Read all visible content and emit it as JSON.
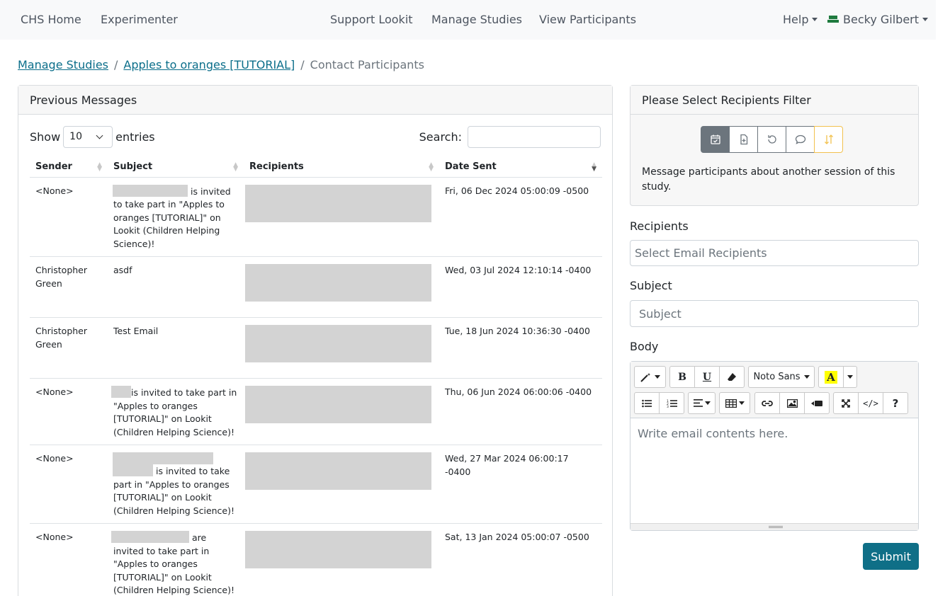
{
  "nav": {
    "home": "CHS Home",
    "experimenter": "Experimenter",
    "support": "Support Lookit",
    "manage": "Manage Studies",
    "participants": "View Participants",
    "help": "Help",
    "user": "Becky Gilbert"
  },
  "breadcrumb": {
    "item1": "Manage Studies",
    "item2": "Apples to oranges [TUTORIAL]",
    "current": "Contact Participants",
    "sep": "/"
  },
  "previous": {
    "title": "Previous Messages",
    "show_label": "Show",
    "entries_value": "10",
    "entries_label": "entries",
    "search_label": "Search:",
    "columns": [
      "Sender",
      "Subject",
      "Recipients",
      "Date Sent"
    ],
    "rows": [
      {
        "sender": "<None>",
        "subject": "is invited to take part in \"Apples to oranges [TUTORIAL]\" on Lookit (Children Helping Science)!",
        "date": "Fri, 06 Dec 2024 05:00:09 -0500"
      },
      {
        "sender": "Christopher Green",
        "subject": "asdf",
        "date": "Wed, 03 Jul 2024 12:10:14 -0400"
      },
      {
        "sender": "Christopher Green",
        "subject": "Test Email",
        "date": "Tue, 18 Jun 2024 10:36:30 -0400"
      },
      {
        "sender": "<None>",
        "subject": "is invited to take part in \"Apples to oranges [TUTORIAL]\" on Lookit (Children Helping Science)!",
        "date": "Thu, 06 Jun 2024 06:00:06 -0400"
      },
      {
        "sender": "<None>",
        "subject": "is invited to take part in \"Apples to oranges [TUTORIAL]\" on Lookit (Children Helping Science)!",
        "date": "Wed, 27 Mar 2024 06:00:17 -0400"
      },
      {
        "sender": "<None>",
        "subject": "are invited to take part in \"Apples to oranges [TUTORIAL]\" on Lookit (Children Helping Science)!",
        "date": "Sat, 13 Jan 2024 05:00:07 -0500"
      }
    ]
  },
  "filter": {
    "title": "Please Select Recipients Filter",
    "icons": [
      "calendar-check-icon",
      "file-plus-icon",
      "refresh-icon",
      "chat-icon",
      "sort-arrows-icon"
    ],
    "description": "Message participants about another session of this study."
  },
  "form": {
    "recipients_label": "Recipients",
    "recipients_placeholder": "Select Email Recipients",
    "subject_label": "Subject",
    "subject_placeholder": "Subject",
    "body_label": "Body",
    "font_name": "Noto Sans",
    "body_placeholder": "Write email contents here.",
    "submit": "Submit"
  },
  "colors": {
    "link": "#0b6e8a",
    "submit": "#0f6f87",
    "active_filter": "#6c757d",
    "highlight_filter": "#f2c14e"
  }
}
